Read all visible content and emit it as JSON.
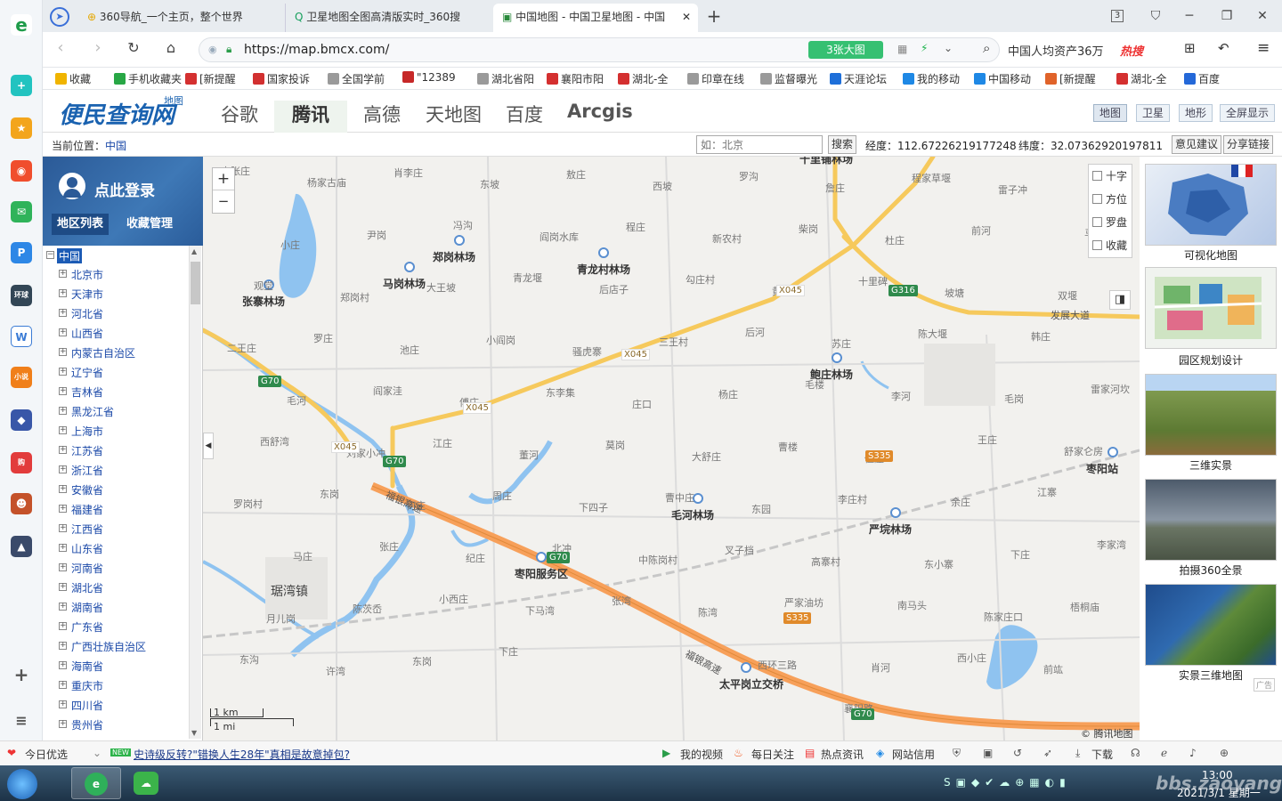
{
  "browser": {
    "tabs": [
      {
        "label": "360导航_一个主页，整个世界"
      },
      {
        "label": "卫星地图全图高清版实时_360搜"
      },
      {
        "label": "中国地图 - 中国卫星地图 - 中国"
      }
    ],
    "tab_count": "3",
    "url": "https://map.bmcx.com/",
    "screenshot_badge": "3张大图",
    "search_text": "中国人均资产36万",
    "hot_search": "热搜"
  },
  "bookmarks": [
    {
      "label": "收藏",
      "color": "#f0b400"
    },
    {
      "label": "手机收藏夹",
      "color": "#28a745"
    },
    {
      "label": "[新提醒",
      "color": "#d43030"
    },
    {
      "label": "国家投诉",
      "color": "#d23030"
    },
    {
      "label": "全国学前",
      "color": "#9a9a9a"
    },
    {
      "label": "\"12389",
      "color": "#c62828"
    },
    {
      "label": "湖北省阳",
      "color": "#9a9a9a"
    },
    {
      "label": "襄阳市阳",
      "color": "#d43030"
    },
    {
      "label": "湖北-全",
      "color": "#d43030"
    },
    {
      "label": "印章在线",
      "color": "#9a9a9a"
    },
    {
      "label": "监督曝光",
      "color": "#9a9a9a"
    },
    {
      "label": "天涯论坛",
      "color": "#1e6fd9"
    },
    {
      "label": "我的移动",
      "color": "#1e88e5"
    },
    {
      "label": "中国移动",
      "color": "#1e88e5"
    },
    {
      "label": "[新提醒",
      "color": "#e0632a"
    },
    {
      "label": "湖北-全",
      "color": "#d43030"
    },
    {
      "label": "百度",
      "color": "#2468d8"
    }
  ],
  "site": {
    "logo_main": "便民查询网",
    "logo_sub": "地图",
    "map_tabs": [
      "谷歌",
      "腾讯",
      "高德",
      "天地图",
      "百度",
      "Arcgis"
    ],
    "active_tab": "腾讯",
    "view_buttons": [
      "地图",
      "卫星",
      "地形",
      "全屏显示"
    ],
    "location_label": "当前位置：",
    "location_value": "中国",
    "search_placeholder": "如：北京",
    "search_button": "搜索",
    "longitude": "经度：112.67226219177248",
    "latitude": "纬度：32.07362920197811",
    "feedback_button": "意见建议",
    "share_button": "分享链接"
  },
  "sidebar": {
    "login_text": "点此登录",
    "tabs": [
      "地区列表",
      "收藏管理"
    ],
    "root": "中国",
    "regions": [
      "北京市",
      "天津市",
      "河北省",
      "山西省",
      "内蒙古自治区",
      "辽宁省",
      "吉林省",
      "黑龙江省",
      "上海市",
      "江苏省",
      "浙江省",
      "安徽省",
      "福建省",
      "江西省",
      "山东省",
      "河南省",
      "湖北省",
      "湖南省",
      "广东省",
      "广西壮族自治区",
      "海南省",
      "重庆市",
      "四川省",
      "贵州省"
    ]
  },
  "map": {
    "zoom_in": "+",
    "zoom_out": "−",
    "toggles": [
      "十字",
      "方位",
      "罗盘",
      "收藏"
    ],
    "scale_km": "1 km",
    "scale_mi": "1 mi",
    "copyright": "© 腾讯地图",
    "pois": [
      "郑岗林场",
      "马岗林场",
      "青龙村林场",
      "张寨林场",
      "鲍庄林场",
      "毛河林场",
      "严垸林场",
      "枣阳服务区",
      "太平岗立交桥",
      "十里铺林场",
      "枣阳站"
    ],
    "places": [
      "小张庄",
      "杨家古庙",
      "肖李庄",
      "东坡",
      "敖庄",
      "西坡",
      "罗沟",
      "詹庄",
      "程家草堰",
      "雷子冲",
      "马岗坡",
      "小庄",
      "尹岗",
      "冯沟",
      "阎岗水库",
      "程庄",
      "新农村",
      "柴岗",
      "杜庄",
      "前河",
      "双堰",
      "观堂",
      "郑岗村",
      "大王坡",
      "青龙堰",
      "后店子",
      "勾庄村",
      "黄堰寺",
      "十里碑",
      "坡塘",
      "韩庄",
      "二王庄",
      "罗庄",
      "池庄",
      "小阎岗",
      "骚虎寨",
      "三王村",
      "后河",
      "苏庄",
      "陈大堰",
      "毛岗",
      "雷家河坎",
      "毛河",
      "阎家洼",
      "傅庄",
      "东李集",
      "庄口",
      "杨庄",
      "毛楼",
      "李河",
      "王庄",
      "舒家仑房",
      "西舒湾",
      "刘家小冲",
      "江庄",
      "董河",
      "莫岗",
      "大舒庄",
      "曹楼",
      "伍庄",
      "余庄",
      "江寨",
      "罗岗村",
      "东岗",
      "何庄",
      "周庄",
      "下四子",
      "曹中庄",
      "东园",
      "李庄村",
      "东小寨",
      "下庄",
      "李家湾",
      "马庄",
      "张庄",
      "纪庄",
      "北冲",
      "中陈岗村",
      "叉子档",
      "高寨村",
      "南马头",
      "陈家庄口",
      "梧桐庙",
      "月儿岗",
      "陈茨岙",
      "小西庄",
      "下马湾",
      "张湾",
      "陈湾",
      "严家油坊",
      "肖河",
      "西小庄",
      "前竑",
      "东沟",
      "许湾",
      "东岗",
      "下庄",
      "琚湾镇",
      "发展大道",
      "西环三路",
      "襄阳路"
    ],
    "roads": [
      "X045",
      "X045",
      "X045",
      "X045",
      "G70",
      "G70",
      "G70",
      "G70",
      "G316",
      "S335",
      "S335"
    ],
    "highway_name": "福银高速"
  },
  "right_panel": [
    {
      "label": "可视化地图"
    },
    {
      "label": "园区规划设计"
    },
    {
      "label": "三维实景"
    },
    {
      "label": "拍摄360全景"
    },
    {
      "label": "实景三维地图"
    }
  ],
  "ad_label": "广告",
  "statusbar": {
    "items": [
      "今日优选",
      "史诗级反转?\"错换人生28年\"真相是故意掉包?",
      "我的视频",
      "每日关注",
      "热点资讯",
      "网站信用",
      "下载"
    ],
    "news_badge": "NEW"
  },
  "taskbar": {
    "time": "13:00",
    "date": "2021/3/1 星期一"
  },
  "watermark": "bbs.zaoyang.org"
}
